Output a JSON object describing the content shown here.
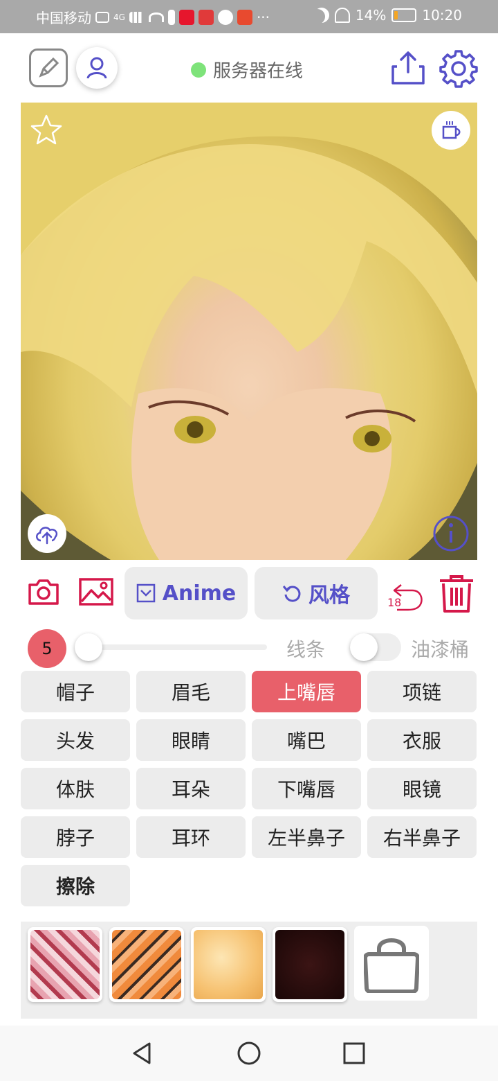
{
  "status_bar": {
    "carrier": "中国移动",
    "network": "4G",
    "battery_percent": "14%",
    "battery_level": 0.14,
    "time": "10:20",
    "more": "···"
  },
  "header": {
    "server_status": "服务器在线",
    "status_color": "#7ee37a"
  },
  "toolbar": {
    "anime_label": "Anime",
    "style_label": "风格",
    "undo_count": "18",
    "accent_color": "#5550c8",
    "danger_color": "#d5184a"
  },
  "brush": {
    "size": "5",
    "slider_value": 0,
    "line_label": "线条",
    "paint_bucket_label": "油漆桶",
    "paint_bucket_on": false
  },
  "regions": [
    {
      "label": "帽子",
      "selected": false
    },
    {
      "label": "眉毛",
      "selected": false
    },
    {
      "label": "上嘴唇",
      "selected": true
    },
    {
      "label": "项链",
      "selected": false
    },
    {
      "label": "头发",
      "selected": false
    },
    {
      "label": "眼睛",
      "selected": false
    },
    {
      "label": "嘴巴",
      "selected": false
    },
    {
      "label": "衣服",
      "selected": false
    },
    {
      "label": "体肤",
      "selected": false
    },
    {
      "label": "耳朵",
      "selected": false
    },
    {
      "label": "下嘴唇",
      "selected": false
    },
    {
      "label": "眼镜",
      "selected": false
    },
    {
      "label": "脖子",
      "selected": false
    },
    {
      "label": "耳环",
      "selected": false
    },
    {
      "label": "左半鼻子",
      "selected": false
    },
    {
      "label": "右半鼻子",
      "selected": false
    },
    {
      "label": "擦除",
      "selected": false
    }
  ],
  "selected_color": "#e8606a"
}
